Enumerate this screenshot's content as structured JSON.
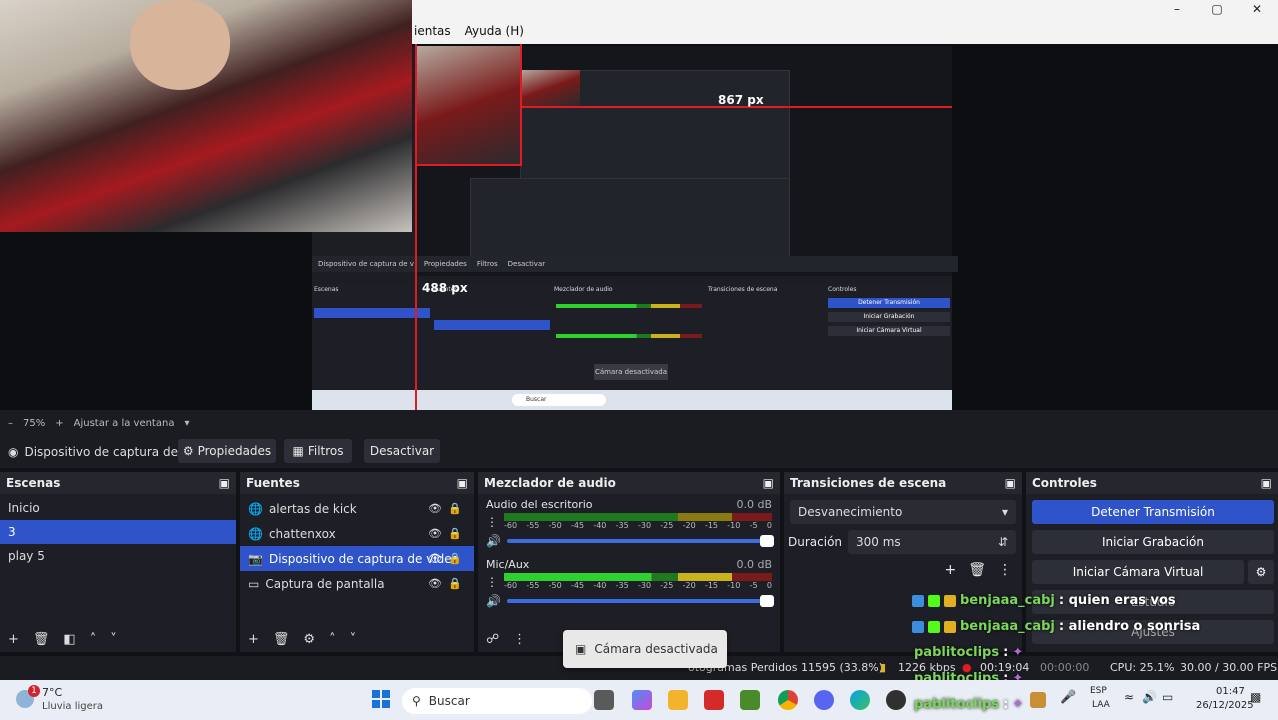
{
  "menu": {
    "items": [
      "ientas",
      "Ayuda (H)"
    ]
  },
  "window_buttons": {
    "minimize": "–",
    "maximize": "▢",
    "close": "✕"
  },
  "preview": {
    "measure_h": "867 px",
    "measure_v": "488 px",
    "nested_toast": "Cámara desactivada",
    "nested_panels": [
      "Escenas",
      "Fuentes",
      "Mezclador de audio",
      "Transiciones de escena",
      "Controles"
    ],
    "nested_source": "Dispositivo de captura de v",
    "nested_buttons": [
      "Propiedades",
      "Filtros",
      "Desactivar"
    ],
    "nested_controls": [
      "Detener Transmisión",
      "Iniciar Grabación",
      "Iniciar Cámara Virtual"
    ],
    "nested_search": "Buscar"
  },
  "zoombar": {
    "minus": "–",
    "zoom": "75%",
    "plus": "+",
    "fit": "Ajustar a la ventana",
    "caret": "▾"
  },
  "source_toolbar": {
    "name": "Dispositivo de captura de v",
    "properties": "Propiedades",
    "filters": "Filtros",
    "deactivate": "Desactivar"
  },
  "scenes": {
    "title": "Escenas",
    "items": [
      {
        "label": "Inicio"
      },
      {
        "label": "3"
      },
      {
        "label": "play 5"
      }
    ],
    "selected_index": 1
  },
  "sources": {
    "title": "Fuentes",
    "items": [
      {
        "label": "alertas de kick",
        "icon": "globe"
      },
      {
        "label": "chattenxox",
        "icon": "globe"
      },
      {
        "label": "Dispositivo de captura de video",
        "icon": "camera"
      },
      {
        "label": "Captura de pantalla",
        "icon": "monitor"
      }
    ],
    "selected_index": 2
  },
  "mixer": {
    "title": "Mezclador de audio",
    "channels": [
      {
        "name": "Audio del escritorio",
        "db": "0.0 dB",
        "level": 0.65
      },
      {
        "name": "Mic/Aux",
        "db": "0.0 dB",
        "level": 0.55
      }
    ],
    "scale": [
      "-60",
      "-55",
      "-50",
      "-45",
      "-40",
      "-35",
      "-30",
      "-25",
      "-20",
      "-15",
      "-10",
      "-5",
      "0"
    ]
  },
  "transitions": {
    "title": "Transiciones de escena",
    "type": "Desvanecimiento",
    "duration_label": "Duración",
    "duration_value": "300 ms"
  },
  "controls": {
    "title": "Controles",
    "stop_stream": "Detener Transmisión",
    "start_record": "Iniciar Grabación",
    "start_vcam": "Iniciar Cámara Virtual",
    "studio": "Estudio",
    "settings": "Ajustes"
  },
  "chat": [
    {
      "user": "benjaaa_cabj",
      "msg": ": quien eras vos"
    },
    {
      "user": "benjaaa_cabj",
      "msg": ": aliendro o sonrisa"
    },
    {
      "user": "pablitoclips",
      "msg": ":"
    },
    {
      "user": "pablitoclips",
      "msg": ":"
    },
    {
      "user": "pablitoclips",
      "msg": ":"
    }
  ],
  "toast": {
    "text": "Cámara desactivada"
  },
  "status": {
    "dropped": "otogramas Perdidos 11595 (33.8%)",
    "kbps": "1226 kbps",
    "stream_time": "00:19:04",
    "rec_time": "00:00:00",
    "cpu": "CPU: 25.1%",
    "fps": "30.00 / 30.00 FPS"
  },
  "taskbar": {
    "weather_temp": "7°C",
    "weather_desc": "Lluvia ligera",
    "weather_badge": "1",
    "search": "Buscar",
    "lang1": "ESP",
    "lang2": "LAA",
    "time": "01:47",
    "date": "26/12/2025"
  },
  "colors": {
    "accent": "#2f54c9",
    "meter_green": "#2fd12f",
    "username": "#7bd65a"
  }
}
